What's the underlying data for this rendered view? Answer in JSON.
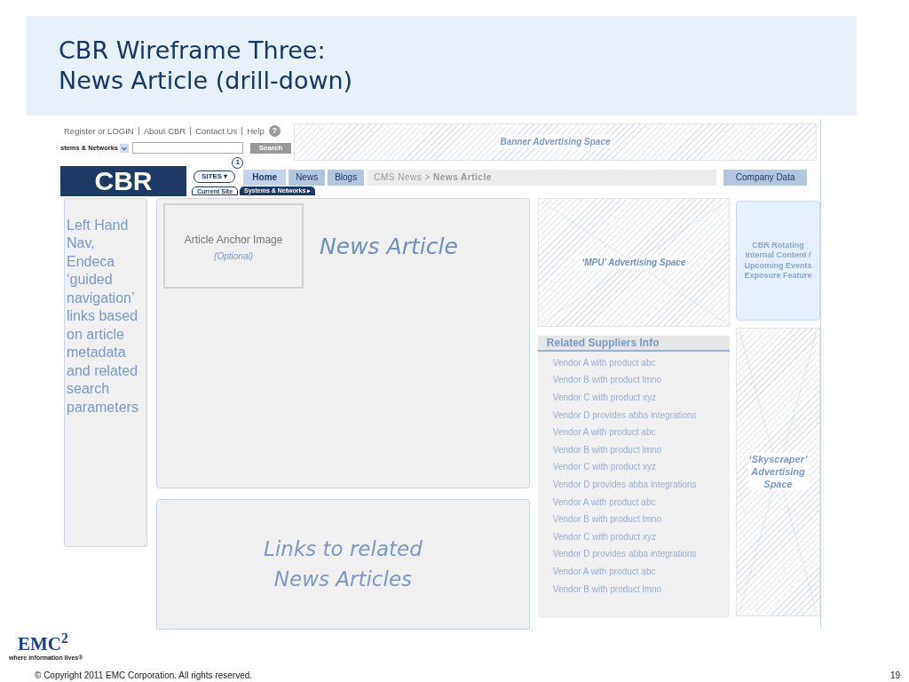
{
  "slide": {
    "title_lines": [
      "CBR Wireframe Three:",
      "News Article (drill-down)"
    ]
  },
  "wireframe": {
    "top_links": [
      "Register or LOGIN",
      "About CBR",
      "Contact Us",
      "Help"
    ],
    "help_icon": "?",
    "search": {
      "dropdown": "stems & Networks",
      "button": "Search"
    },
    "banner": "Banner Advertising Space",
    "logo": "CBR",
    "nav": {
      "sites_button": "SITES ▾",
      "badge": "1",
      "tabs": [
        {
          "label": "Home",
          "selected": true
        },
        {
          "label": "News",
          "selected": false
        },
        {
          "label": "Blogs",
          "selected": false
        }
      ],
      "breadcrumb": "CMS News > **News Article**",
      "right_tab": "Company Data",
      "pills": [
        "Current Site",
        "Systems & Networks ▸"
      ]
    },
    "left_nav": "Left Hand Nav, Endeca ‘guided navigation’ links based on article metadata and related search parameters",
    "article": {
      "image_label": "Article Anchor Image",
      "image_note": "(Optional)",
      "heading": "News Article"
    },
    "related_links": "Links to related News Articles",
    "mpu": "‘MPU’ Advertising Space",
    "rotating": "CBR Rotating Internal Content / Upcoming Events Exposure Feature",
    "suppliers": {
      "title": "Related Suppliers Info",
      "items": [
        "Vendor A with product abc",
        "Vendor B with product lmno",
        "Vendor C with product xyz",
        "Vendor D provides abba integrations",
        "Vendor A with product abc",
        "Vendor B with product lmno",
        "Vendor C with product xyz",
        "Vendor D provides abba integrations",
        "Vendor A with product abc",
        "Vendor B with product lmno",
        "Vendor C with product xyz",
        "Vendor D provides abba integrations",
        "Vendor A with product abc",
        "Vendor B with product lmno"
      ]
    },
    "skyscraper": "‘Skyscraper’ Advertising Space"
  },
  "footer": {
    "logo": "EMC$^{2}$",
    "tagline": "where information lives®",
    "copyright": "© Copyright 2011 EMC Corporation. All rights reserved.",
    "page": "19"
  }
}
